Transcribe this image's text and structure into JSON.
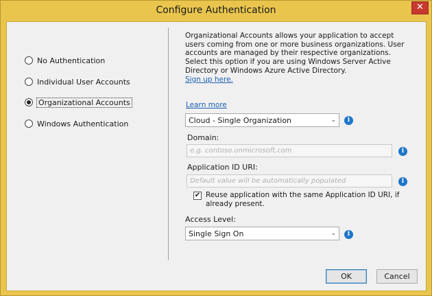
{
  "window": {
    "title": "Configure Authentication",
    "close_glyph": "✕"
  },
  "auth_options": [
    {
      "label": "No Authentication",
      "checked": false
    },
    {
      "label": "Individual User Accounts",
      "checked": false
    },
    {
      "label": "Organizational Accounts",
      "checked": true
    },
    {
      "label": "Windows Authentication",
      "checked": false
    }
  ],
  "description": {
    "text": "Organizational Accounts allows your application to accept users coming from one or more business organizations. User accounts are managed by their respective organizations. Select this option if you are using Windows Server Active Directory or Windows Azure Active Directory.",
    "signup_link": "Sign up here."
  },
  "learn_more": "Learn more",
  "org_type": {
    "value": "Cloud - Single Organization"
  },
  "domain": {
    "label": "Domain:",
    "placeholder": "e.g. contoso.onmicrosoft.com"
  },
  "app_id_uri": {
    "label": "Application ID URI:",
    "placeholder": "Default value will be automatically populated"
  },
  "reuse_checkbox": {
    "checked": true,
    "check_glyph": "✔",
    "label": "Reuse application with the same Application ID URI, if already present."
  },
  "access_level": {
    "label": "Access Level:",
    "value": "Single Sign On"
  },
  "buttons": {
    "ok": "OK",
    "cancel": "Cancel"
  },
  "info_glyph": "i",
  "chevron_glyph": "⌄"
}
